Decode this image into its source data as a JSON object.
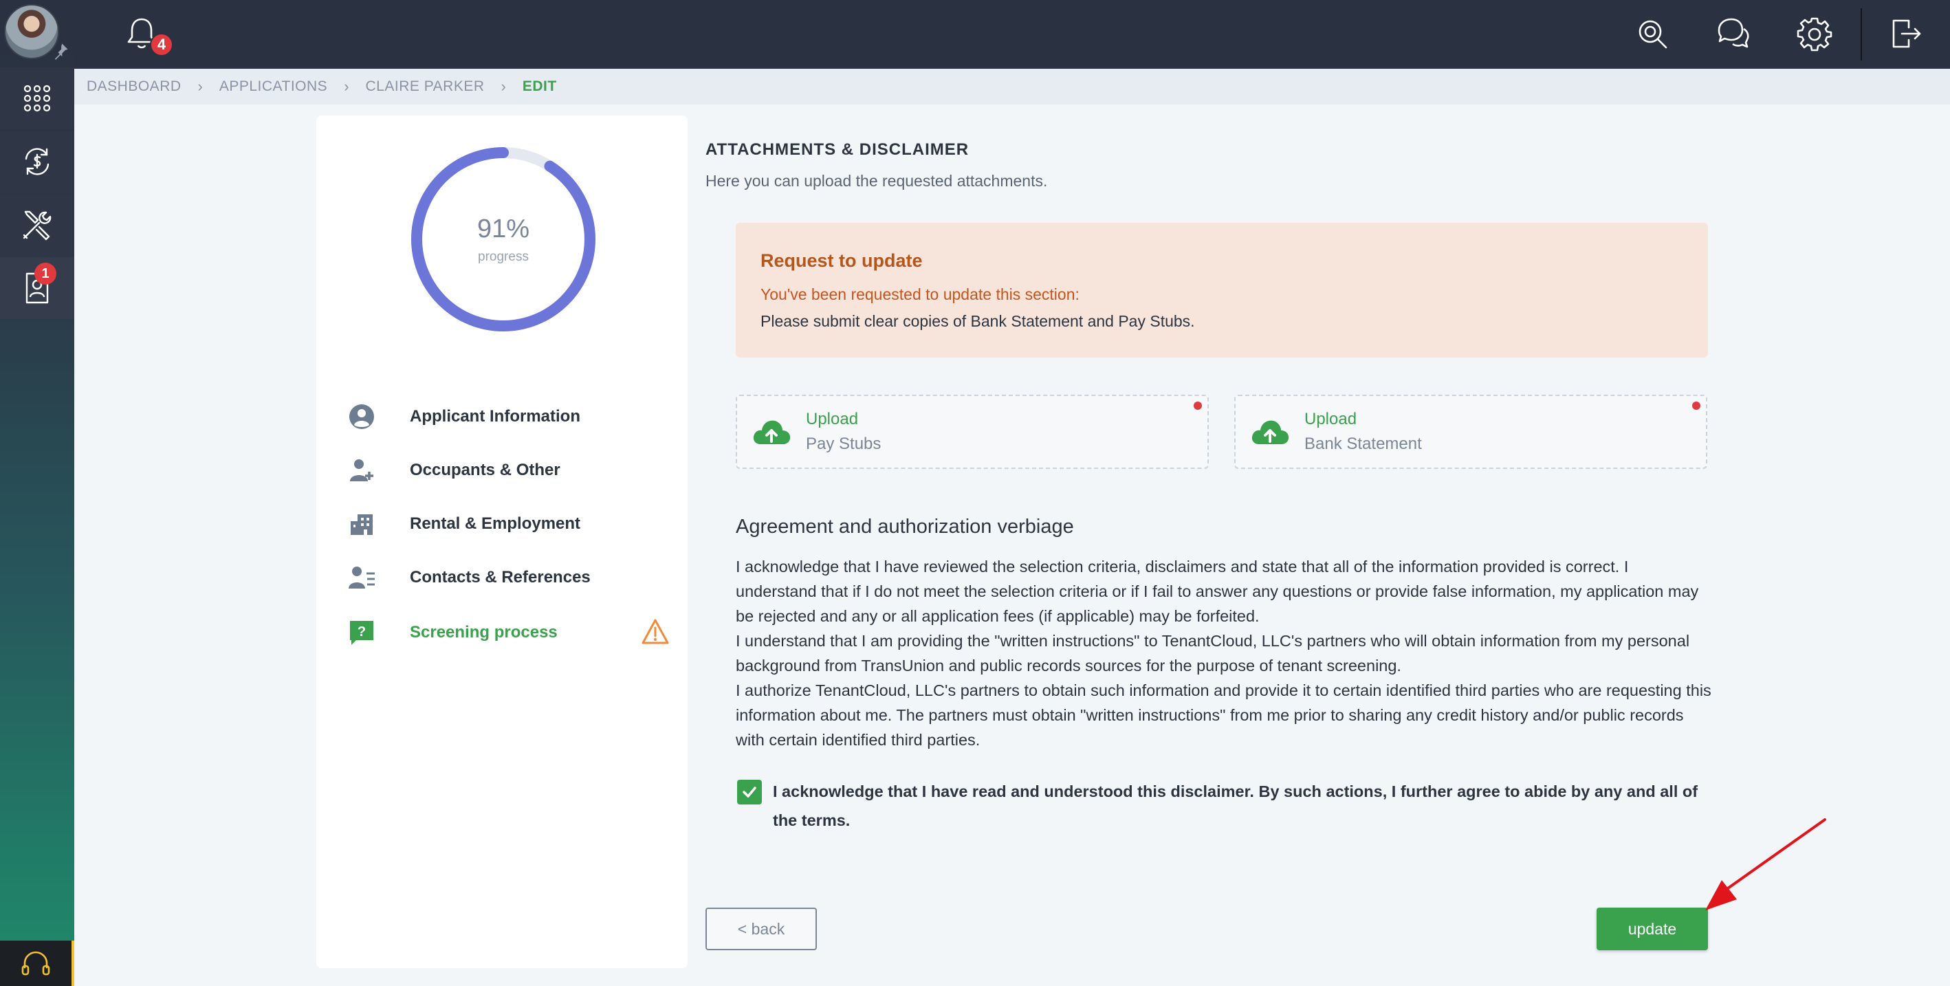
{
  "sidebar": {
    "items": [
      {
        "icon": "apps-grid-icon"
      },
      {
        "icon": "money-exchange-icon"
      },
      {
        "icon": "tools-icon"
      },
      {
        "icon": "tenant-profile-icon",
        "badge": "1"
      }
    ],
    "support_icon": "headset-icon"
  },
  "topbar": {
    "notification_count": "4",
    "icons": [
      "search-icon",
      "chat-icon",
      "settings-icon",
      "logout-icon"
    ]
  },
  "breadcrumb": {
    "items": [
      "DASHBOARD",
      "APPLICATIONS",
      "CLAIRE PARKER",
      "EDIT"
    ]
  },
  "progress": {
    "value": 91,
    "percent_label": "91%",
    "label": "progress"
  },
  "steps": [
    {
      "label": "Applicant Information",
      "icon": "user-circle-icon",
      "state": "normal"
    },
    {
      "label": "Occupants & Other",
      "icon": "add-user-icon",
      "state": "normal"
    },
    {
      "label": "Rental & Employment",
      "icon": "building-icon",
      "state": "normal"
    },
    {
      "label": "Contacts & References",
      "icon": "contacts-list-icon",
      "state": "normal"
    },
    {
      "label": "Screening process",
      "icon": "question-chat-icon",
      "state": "active",
      "warning": true
    }
  ],
  "section": {
    "title": "ATTACHMENTS & DISCLAIMER",
    "subtitle": "Here you can upload the requested attachments."
  },
  "alert": {
    "title": "Request to update",
    "line1": "You've been requested to update this section:",
    "line2": "Please submit clear copies of Bank Statement and Pay Stubs."
  },
  "uploads": [
    {
      "title": "Upload",
      "subtitle": "Pay Stubs"
    },
    {
      "title": "Upload",
      "subtitle": "Bank Statement"
    }
  ],
  "agreement": {
    "title": "Agreement and authorization verbiage",
    "paragraphs": [
      "I acknowledge that I have reviewed the selection criteria, disclaimers and state that all of the information provided is correct. I understand that if I do not meet the selection criteria or if I fail to answer any questions or provide false information, my application may be rejected and any or all application fees (if applicable) may be forfeited.",
      "I understand that I am providing the \"written instructions\" to TenantCloud, LLC's partners who will obtain information from my personal background from TransUnion and public records sources for the purpose of tenant screening.",
      "I authorize TenantCloud, LLC's partners to obtain such information and provide it to certain identified third parties who are requesting this information about me. The partners must obtain \"written instructions\" from me prior to sharing any credit history and/or public records with certain identified third parties."
    ],
    "checkbox_checked": true,
    "checkbox_label": "I acknowledge that I have read and understood this disclaimer. By such actions, I further agree to abide by any and all of the terms."
  },
  "buttons": {
    "back": "< back",
    "update": "update"
  },
  "colors": {
    "accent_green": "#3aa14c",
    "progress_ring": "#6b76d8",
    "alert_bg": "#f7e5dc",
    "badge_red": "#e0393e",
    "warning_orange": "#f08a3c"
  }
}
